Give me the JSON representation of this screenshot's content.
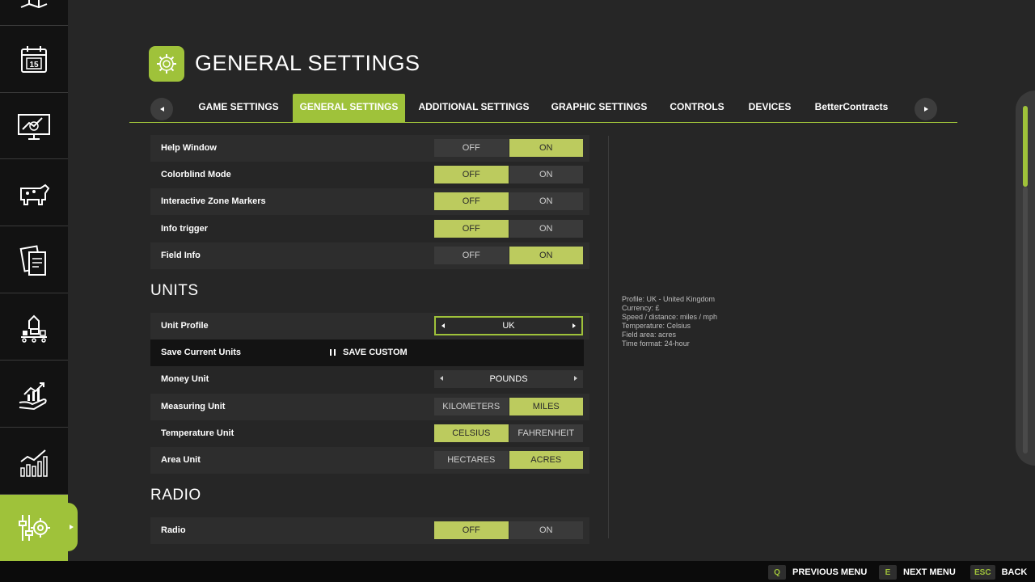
{
  "header": {
    "title": "GENERAL SETTINGS",
    "icon": "gear-icon"
  },
  "tabs": [
    {
      "label": "GAME SETTINGS",
      "active": false
    },
    {
      "label": "GENERAL SETTINGS",
      "active": true
    },
    {
      "label": "ADDITIONAL SETTINGS",
      "active": false
    },
    {
      "label": "GRAPHIC SETTINGS",
      "active": false
    },
    {
      "label": "CONTROLS",
      "active": false
    },
    {
      "label": "DEVICES",
      "active": false
    },
    {
      "label": "BetterContracts",
      "active": false
    }
  ],
  "sidebar": {
    "items": [
      {
        "icon": "map-icon"
      },
      {
        "icon": "calendar-icon",
        "text": "15"
      },
      {
        "icon": "price-monitor-icon"
      },
      {
        "icon": "animals-icon"
      },
      {
        "icon": "contracts-icon"
      },
      {
        "icon": "production-icon"
      },
      {
        "icon": "finances-icon"
      },
      {
        "icon": "statistics-icon"
      },
      {
        "icon": "settings-icon",
        "active": true
      }
    ]
  },
  "general": {
    "help_window": {
      "label": "Help Window",
      "off": "OFF",
      "on": "ON",
      "value": "ON"
    },
    "colorblind": {
      "label": "Colorblind Mode",
      "off": "OFF",
      "on": "ON",
      "value": "OFF"
    },
    "zone_markers": {
      "label": "Interactive Zone Markers",
      "off": "OFF",
      "on": "ON",
      "value": "OFF"
    },
    "info_trigger": {
      "label": "Info trigger",
      "off": "OFF",
      "on": "ON",
      "value": "OFF"
    },
    "field_info": {
      "label": "Field Info",
      "off": "OFF",
      "on": "ON",
      "value": "ON"
    }
  },
  "units": {
    "title": "UNITS",
    "unit_profile": {
      "label": "Unit Profile",
      "value": "UK"
    },
    "save_units": {
      "label": "Save Current Units",
      "button": "SAVE CUSTOM"
    },
    "money_unit": {
      "label": "Money Unit",
      "value": "POUNDS"
    },
    "measuring_unit": {
      "label": "Measuring Unit",
      "a": "KILOMETERS",
      "b": "MILES",
      "value": "MILES"
    },
    "temperature_unit": {
      "label": "Temperature Unit",
      "a": "CELSIUS",
      "b": "FAHRENHEIT",
      "value": "CELSIUS"
    },
    "area_unit": {
      "label": "Area Unit",
      "a": "HECTARES",
      "b": "ACRES",
      "value": "ACRES"
    }
  },
  "radio": {
    "title": "RADIO",
    "radio": {
      "label": "Radio",
      "off": "OFF",
      "on": "ON",
      "value": "OFF"
    }
  },
  "info_panel": {
    "lines": [
      "Profile: UK - United Kingdom",
      "Currency: £",
      "Speed / distance: miles / mph",
      "Temperature: Celsius",
      "Field area: acres",
      "Time format: 24-hour"
    ]
  },
  "footer": {
    "prev": {
      "key": "Q",
      "label": "PREVIOUS MENU"
    },
    "next": {
      "key": "E",
      "label": "NEXT MENU"
    },
    "back": {
      "key": "ESC",
      "label": "BACK"
    }
  },
  "colors": {
    "accent": "#9fc23a",
    "selected_option": "#bccb5e",
    "background": "#262626",
    "sidebar": "#121212"
  }
}
